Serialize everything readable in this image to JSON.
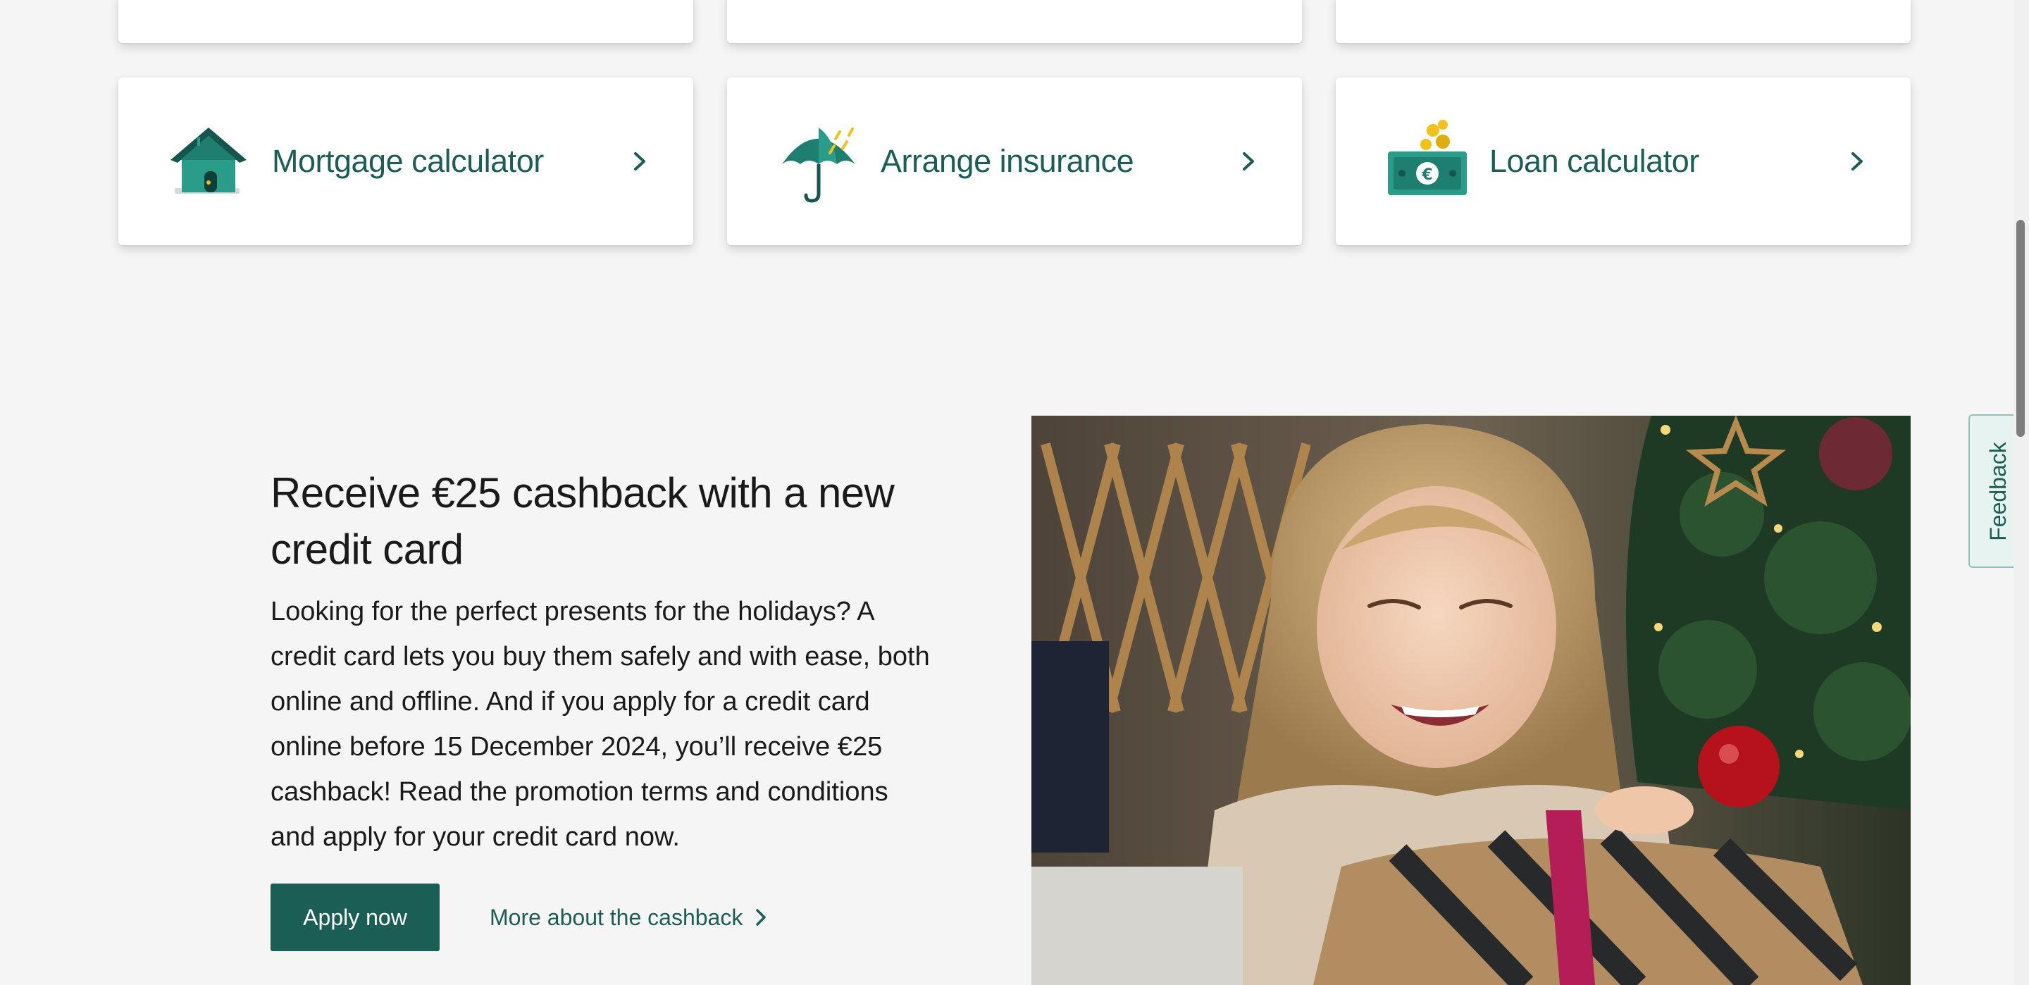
{
  "tools": [
    {
      "label": "Mortgage calculator",
      "icon": "house-icon"
    },
    {
      "label": "Arrange insurance",
      "icon": "umbrella-icon"
    },
    {
      "label": "Loan calculator",
      "icon": "money-coins-icon"
    }
  ],
  "promo": {
    "title": "Receive €25 cashback with a new credit card",
    "body": "Looking for the perfect presents for the holidays? A credit card lets you buy them safely and with ease, both online and offline. And if you apply for a credit card online before 15 December 2024, you’ll receive €25 cashback! Read the promotion terms and conditions and apply for your credit card now.",
    "apply_label": "Apply now",
    "more_label": "More about the cashback",
    "image_subject": "smiling girl opening a gift by a Christmas tree"
  },
  "feedback_label": "Feedback",
  "colors": {
    "brand": "#1b5e55",
    "background": "#f5f5f5",
    "card": "#ffffff",
    "icon_accent": "#f2c21b"
  }
}
